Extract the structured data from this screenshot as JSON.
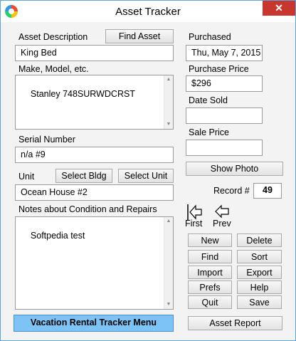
{
  "window": {
    "title": "Asset Tracker",
    "close_glyph": "✕"
  },
  "left": {
    "asset_description_label": "Asset Description",
    "find_asset_button": "Find Asset",
    "asset_description_value": "King Bed",
    "make_model_label": "Make, Model, etc.",
    "make_model_value": "Stanley 748SURWDCRST",
    "serial_number_label": "Serial Number",
    "serial_number_value": "n/a #9",
    "unit_label": "Unit",
    "select_bldg_button": "Select Bldg",
    "select_unit_button": "Select Unit",
    "unit_value": "Ocean House #2",
    "notes_label": "Notes about Condition and Repairs",
    "notes_value": "Softpedia test",
    "menu_button": "Vacation Rental Tracker Menu"
  },
  "right": {
    "purchased_label": "Purchased",
    "purchased_value": "Thu, May 7, 2015",
    "purchase_price_label": "Purchase Price",
    "purchase_price_value": "$296",
    "date_sold_label": "Date Sold",
    "date_sold_value": "",
    "sale_price_label": "Sale Price",
    "sale_price_value": "",
    "show_photo_button": "Show Photo",
    "record_label": "Record #",
    "record_value": "49",
    "first_label": "First",
    "prev_label": "Prev",
    "buttons": {
      "new": "New",
      "delete": "Delete",
      "find": "Find",
      "sort": "Sort",
      "import": "Import",
      "export": "Export",
      "prefs": "Prefs",
      "help": "Help",
      "quit": "Quit",
      "save": "Save"
    },
    "asset_report_button": "Asset Report"
  },
  "icons": {
    "app": "colorful-circle-icon",
    "first": "first-record-arrow-icon",
    "prev": "prev-record-arrow-icon"
  }
}
